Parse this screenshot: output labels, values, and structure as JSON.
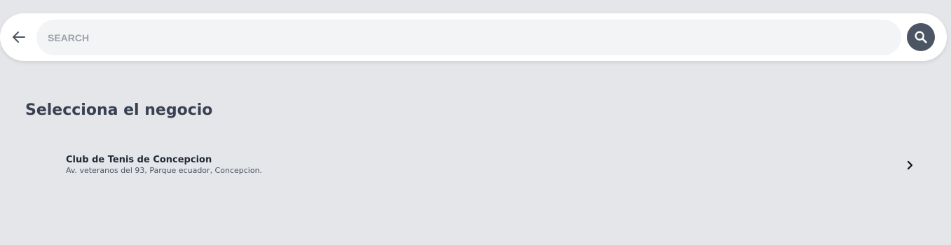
{
  "search": {
    "placeholder": "SEARCH",
    "value": ""
  },
  "icons": {
    "back": "arrow-left-icon",
    "search": "search-icon",
    "chevron": "chevron-right-icon"
  },
  "colors": {
    "background": "#e5e6e9",
    "search_button": "#4b5563",
    "title": "#374151"
  },
  "page": {
    "title": "Selecciona el negocio"
  },
  "businesses": [
    {
      "name": "Club de Tenis de Concepcion",
      "address": "Av. veteranos del 93, Parque ecuador, Concepcion."
    }
  ]
}
